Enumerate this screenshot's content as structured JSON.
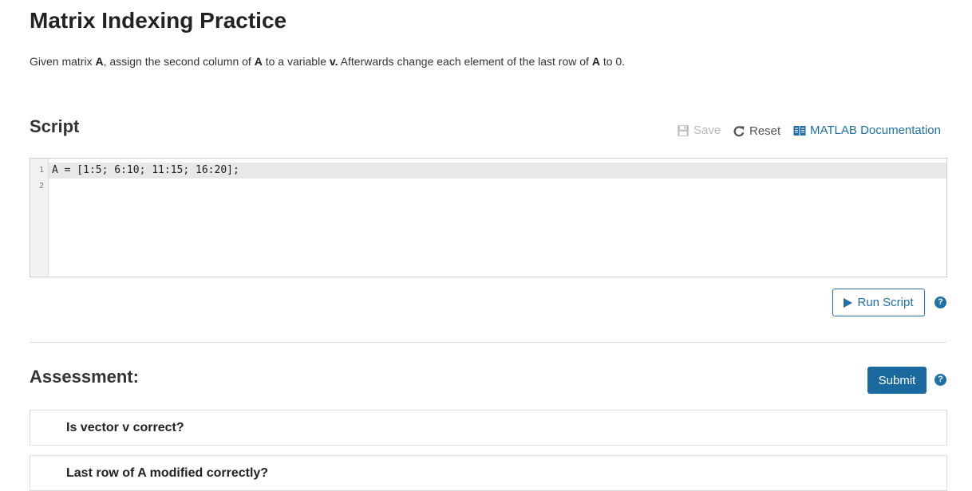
{
  "page": {
    "title": "Matrix Indexing Practice",
    "description": {
      "p1": "Given matrix ",
      "b1": "A",
      "p2": ", assign the second column of ",
      "b2": "A",
      "p3": " to a variable ",
      "b3": "v.",
      "p4": "  Afterwards change each element of the last row of ",
      "b4": "A",
      "p5": " to 0."
    }
  },
  "script": {
    "heading": "Script",
    "toolbar": {
      "save_label": "Save",
      "save_icon": "floppy-disk-icon",
      "reset_label": "Reset",
      "reset_icon": "reset-arrow-icon",
      "doc_label": "MATLAB Documentation",
      "doc_icon": "book-icon"
    },
    "editor": {
      "lines": [
        {
          "number": "1",
          "code": "A = [1:5; 6:10; 11:15; 16:20];"
        },
        {
          "number": "2",
          "code": ""
        }
      ]
    },
    "run_label": "Run Script",
    "help_glyph": "?"
  },
  "assessment": {
    "heading": "Assessment:",
    "submit_label": "Submit",
    "help_glyph": "?",
    "items": [
      {
        "label": "Is vector v correct?"
      },
      {
        "label": "Last row of A modified correctly?"
      }
    ]
  },
  "colors": {
    "accent": "#1f6fa8",
    "submit_bg": "#1a6aa0",
    "disabled": "#b8b8b8"
  }
}
